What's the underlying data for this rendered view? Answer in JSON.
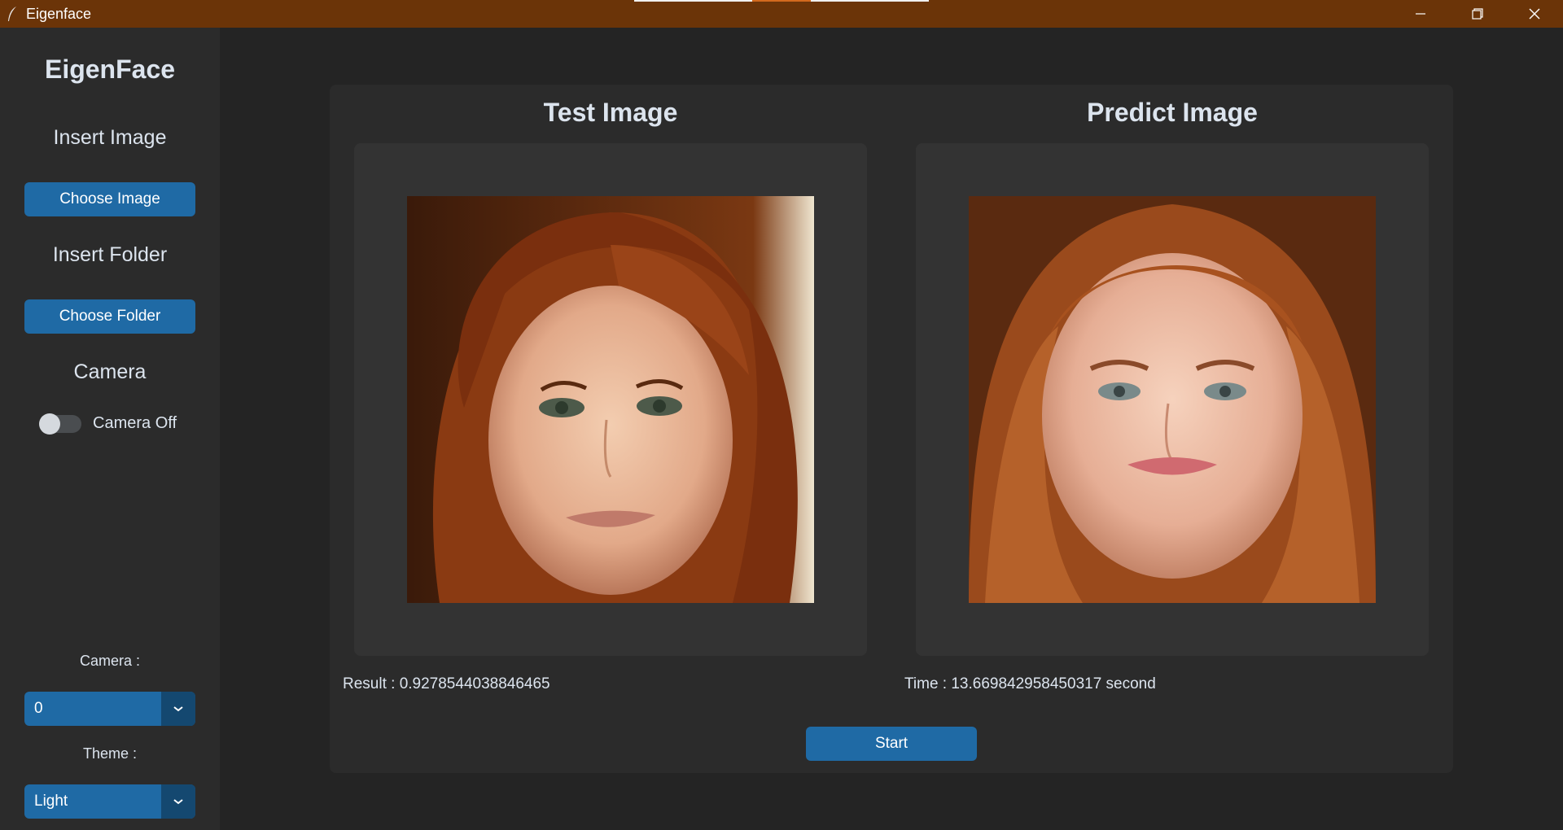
{
  "window": {
    "title": "Eigenface",
    "controls": [
      "minimize-icon",
      "restore-icon",
      "close-icon"
    ],
    "titlebar_color": "#6b3408"
  },
  "sidebar": {
    "app_name": "EigenFace",
    "insert_image_label": "Insert Image",
    "choose_image_button": "Choose Image",
    "insert_folder_label": "Insert Folder",
    "choose_folder_button": "Choose Folder",
    "camera_label": "Camera",
    "camera_switch_label": "Camera Off",
    "camera_switch_on": false,
    "camera_select_label": "Camera :",
    "camera_select_value": "0",
    "theme_select_label": "Theme :",
    "theme_select_value": "Light"
  },
  "main": {
    "test_image_title": "Test Image",
    "predict_image_title": "Predict Image",
    "result_text": "Result : 0.9278544038846465",
    "time_text": "Time : 13.669842958450317 second",
    "start_button": "Start"
  },
  "colors": {
    "accent": "#1f6aa5",
    "accent_dark": "#144870",
    "background": "#242424",
    "panel": "#2b2b2b",
    "frame": "#333333"
  }
}
